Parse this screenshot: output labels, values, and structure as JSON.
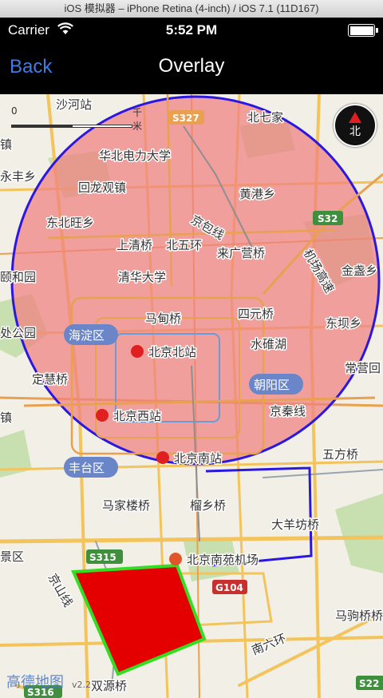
{
  "simulator": {
    "title": "iOS 模拟器 – iPhone Retina (4-inch) / iOS 7.1 (11D167)"
  },
  "status": {
    "carrier": "Carrier",
    "time": "5:52 PM",
    "battery_level": 1.0
  },
  "nav": {
    "back_label": "Back",
    "title": "Overlay"
  },
  "map": {
    "scale": {
      "zero": "0",
      "unit": "千米"
    },
    "compass_label": "北",
    "logo": "高德地图",
    "version": "v2.2",
    "labels": {
      "shahezhan": "沙河站",
      "s327": "S327",
      "beiqijia": "北七家",
      "huabei": "华北电力大学",
      "huilongguan": "回龙观镇",
      "huanggang": "黄港乡",
      "dongbeiwang": "东北旺乡",
      "jingbaoxian": "京包线",
      "s32": "S32",
      "shangqing": "上清桥",
      "beiwuhuan": "北五环",
      "laiguangying": "来广营桥",
      "jichang": "机场高速",
      "jinzhanxiang": "金盏乡",
      "yiheyuan": "颐和园",
      "qinghua": "清华大学",
      "madian": "马甸桥",
      "siyuan": "四元桥",
      "dongba": "东坝乡",
      "haidian": "海淀区",
      "beijingbeizhan": "北京北站",
      "shuiduihu": "水碓湖",
      "changying": "常营回",
      "dinghui": "定慧桥",
      "chaoyang": "朝阳区",
      "jingqin": "京秦线",
      "beijingxizhan": "北京西站",
      "beijingnanzhan": "北京南站",
      "wufang": "五方桥",
      "fengtai": "丰台区",
      "majialou": "马家楼桥",
      "liuxiang": "榴乡桥",
      "dayangfang": "大羊坊桥",
      "s315": "S315",
      "nanyuan": "北京南苑机场",
      "g104": "G104",
      "jingshan": "京山线",
      "majuqiao": "马驹桥桥",
      "nanliuhuan": "南六环",
      "shuangyuan": "双源桥",
      "s22": "S22",
      "yongfeng": "永丰乡",
      "zhen1": "镇",
      "zhen2": "镇",
      "jingqu": "景区",
      "yunqiao": "处公园",
      "s316": "S316"
    }
  },
  "overlays": {
    "circle": {
      "fill": "#f08080",
      "fill_opacity": 0.72,
      "stroke": "#2a18e0"
    },
    "polyline": {
      "stroke": "#2a18e0"
    },
    "polygon": {
      "fill": "#e50000",
      "stroke": "#33dd22"
    }
  }
}
